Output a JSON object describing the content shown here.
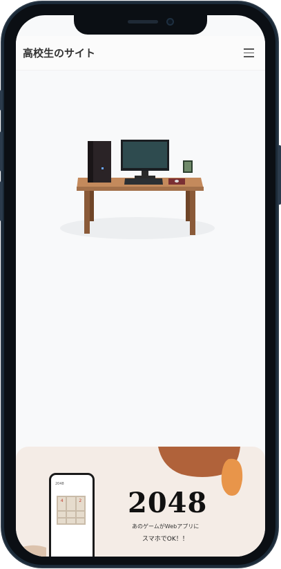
{
  "header": {
    "site_title": "高校生のサイト"
  },
  "promo": {
    "title": "2048",
    "subtitle": "あのゲームがWebアプリに",
    "tagline": "スマホでOK！！",
    "mini_app": {
      "title": "2048",
      "tiles": [
        "4",
        "2"
      ]
    }
  },
  "icons": {
    "menu": "hamburger-menu-icon"
  },
  "colors": {
    "promo_bg": "#f4ece6",
    "accent_brown": "#b0623a",
    "accent_orange": "#e8954a"
  }
}
